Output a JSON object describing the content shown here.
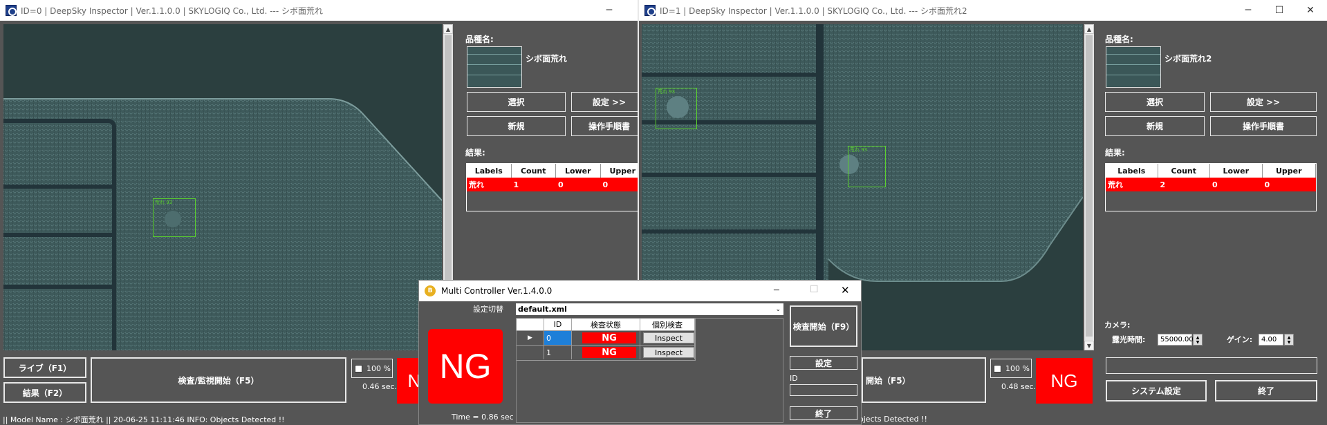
{
  "win0": {
    "title": "ID=0 | DeepSky Inspector | Ver.1.1.0.0 | SKYLOGIQ Co., Ltd. --- シボ面荒れ",
    "minimize": "─",
    "product_label": "品種名:",
    "product_name": "シボ面荒れ",
    "select_btn": "選択",
    "settings_btn": "設定 >>",
    "new_btn": "新規",
    "manual_btn": "操作手順書",
    "result_label": "結果:",
    "table_headers": [
      "Labels",
      "Count",
      "Lower",
      "Upper"
    ],
    "table_row": [
      "荒れ",
      "1",
      "0",
      "0"
    ],
    "det_label": "荒れ 93",
    "live_btn": "ライブ（F1）",
    "result_btn": "結果（F2）",
    "inspect_btn": "検査/監視開始（F5）",
    "zoom": "100 %",
    "time": "0.46 sec.",
    "ng": "NG",
    "status": "|| Model Name : シボ面荒れ ||    20-06-25 11:11:46    INFO:  Objects Detected !!"
  },
  "win1": {
    "title": "ID=1 | DeepSky Inspector | Ver.1.1.0.0 | SKYLOGIQ Co., Ltd. --- シボ面荒れ2",
    "minimize": "─",
    "maximize": "☐",
    "close": "✕",
    "product_label": "品種名:",
    "product_name": "シボ面荒れ2",
    "select_btn": "選択",
    "settings_btn": "設定 >>",
    "new_btn": "新規",
    "manual_btn": "操作手順書",
    "result_label": "結果:",
    "table_headers": [
      "Labels",
      "Count",
      "Lower",
      "Upper"
    ],
    "table_row": [
      "荒れ",
      "2",
      "0",
      "0"
    ],
    "det_label1": "荒れ 93",
    "det_label2": "荒れ 93",
    "camera_label": "カメラ:",
    "exposure_label": "露光時間:",
    "exposure_value": "55000.00",
    "gain_label": "ゲイン:",
    "gain_value": "4.00",
    "inspect_btn": "開始（F5）",
    "zoom": "100 %",
    "time": "0.48 sec.",
    "ng": "NG",
    "system_btn": "システム設定",
    "exit_btn": "終了",
    "status": "ojects Detected !!"
  },
  "mc": {
    "title": "Multi Controller Ver.1.4.0.0",
    "icon_letter": "B",
    "minimize": "─",
    "maximize": "☐",
    "close": "✕",
    "config_label": "設定切替",
    "config_value": "default.xml",
    "ng": "NG",
    "time": "Time = 0.86 sec",
    "grid_headers": [
      "",
      "ID",
      "検査状態",
      "個別検査"
    ],
    "rows": [
      {
        "marker": "▶",
        "id": "0",
        "status": "NG",
        "btn": "Inspect"
      },
      {
        "marker": "",
        "id": "1",
        "status": "NG",
        "btn": "Inspect"
      }
    ],
    "start_btn": "検査開始（F9）",
    "settings_btn": "設定",
    "id_label": "ID",
    "exit_btn": "終了"
  }
}
